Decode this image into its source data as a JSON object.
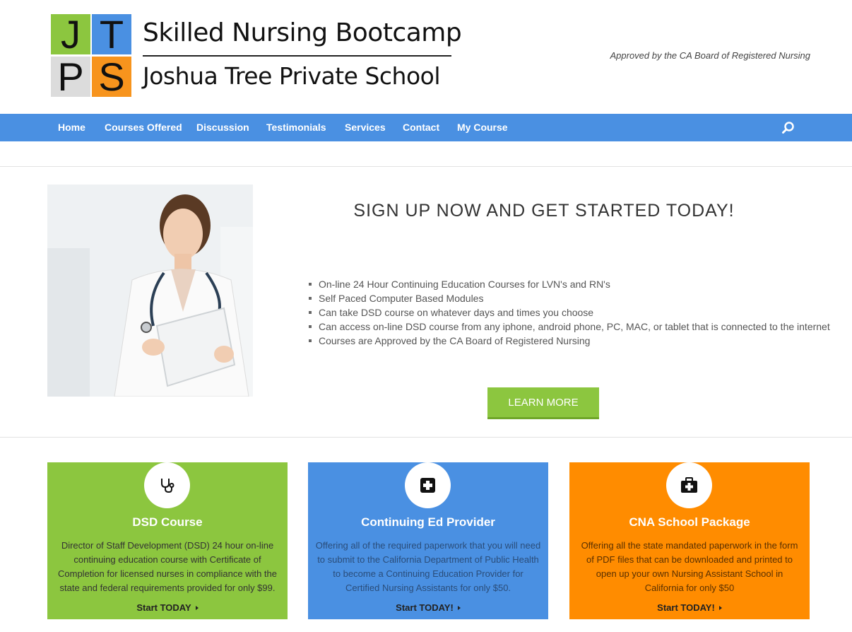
{
  "header": {
    "logo_letters": [
      "J",
      "T",
      "P",
      "S"
    ],
    "logo_title": "Skilled Nursing Bootcamp",
    "logo_subtitle": "Joshua Tree Private School",
    "tagline": "Approved by the CA Board of Registered Nursing"
  },
  "nav": {
    "items": [
      "Home",
      "Courses Offered",
      "Discussion",
      "Testimonials",
      "Services",
      "Contact",
      "My Course"
    ],
    "search_icon": "search-icon"
  },
  "hero": {
    "title": "SIGN UP NOW AND GET STARTED TODAY!",
    "bullets": [
      "On-line 24 Hour Continuing Education Courses for LVN's and RN's",
      "Self Paced Computer Based Modules",
      "Can take DSD course on whatever days and times you choose",
      "Can access on-line DSD course from any iphone, android phone, PC, MAC, or tablet that is connected to the internet",
      "Courses are Approved by the CA Board of Registered Nursing"
    ],
    "button": "LEARN MORE"
  },
  "cards": [
    {
      "icon": "stethoscope-icon",
      "title": "DSD Course",
      "text": "Director of Staff Development (DSD) 24 hour on-line continuing education course with Certificate of Completion for licensed nurses in compliance with the state and federal requirements provided for only $99.",
      "link": "Start TODAY"
    },
    {
      "icon": "medical-plus-icon",
      "title": "Continuing Ed Provider",
      "text": "Offering all of the required paperwork that you will need to submit to the California Department of Public Health to become a Continuing Education Provider for Certified Nursing Assistants for only $50.",
      "link": "Start TODAY!"
    },
    {
      "icon": "medkit-icon",
      "title": "CNA School Package",
      "text": "Offering all the state mandated paperwork in the form of PDF files that can be downloaded and printed to open up your own Nursing Assistant School in California for only $50",
      "link": "Start TODAY!"
    }
  ],
  "colors": {
    "nav_blue": "#4a90e2",
    "green": "#8cc63f",
    "orange": "#ff8c00"
  }
}
